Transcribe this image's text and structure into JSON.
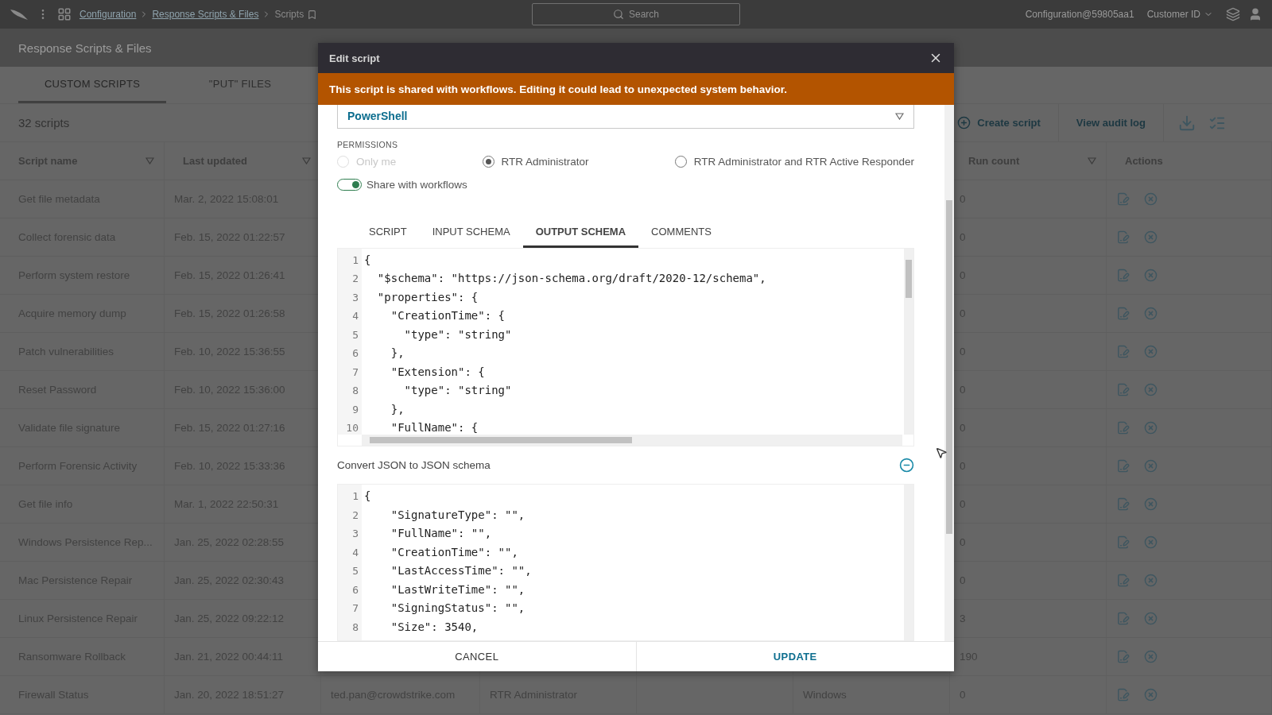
{
  "top_bar": {
    "breadcrumbs": [
      "Configuration",
      "Response Scripts & Files",
      "Scripts"
    ],
    "search": {
      "placeholder": "Search"
    },
    "account": "Configuration@59805aa1",
    "customer_menu": "Customer ID"
  },
  "page_title": "Response Scripts & Files",
  "tabs": [
    {
      "label": "CUSTOM SCRIPTS",
      "selected": true
    },
    {
      "label": "\"PUT\" FILES",
      "selected": false
    }
  ],
  "toolbar": {
    "count": "32 scripts",
    "create": "Create script",
    "audit": "View audit log"
  },
  "table": {
    "columns": [
      {
        "label": "Script name",
        "filter": true
      },
      {
        "label": "Last updated",
        "filter": true
      },
      {
        "label": "Run count",
        "filter": true
      },
      {
        "label": "Actions",
        "filter": false
      }
    ],
    "rows": [
      {
        "name": "Get file metadata",
        "last_updated": "Mar. 2, 2022 15:08:01",
        "run_count": "0"
      },
      {
        "name": "Collect forensic data",
        "last_updated": "Feb. 15, 2022 01:22:57",
        "run_count": "0"
      },
      {
        "name": "Perform system restore",
        "last_updated": "Feb. 15, 2022 01:26:41",
        "run_count": "0"
      },
      {
        "name": "Acquire memory dump",
        "last_updated": "Feb. 15, 2022 01:26:58",
        "run_count": "0"
      },
      {
        "name": "Patch vulnerabilities",
        "last_updated": "Feb. 10, 2022 15:36:55",
        "run_count": "0"
      },
      {
        "name": "Reset Password",
        "last_updated": "Feb. 10, 2022 15:36:00",
        "run_count": "0"
      },
      {
        "name": "Validate file signature",
        "last_updated": "Feb. 15, 2022 01:27:16",
        "run_count": "0"
      },
      {
        "name": "Perform Forensic Activity",
        "last_updated": "Feb. 10, 2022 15:33:36",
        "run_count": "0"
      },
      {
        "name": "Get file info",
        "last_updated": "Mar. 1, 2022 22:50:31",
        "run_count": "0"
      },
      {
        "name": "Windows Persistence Rep...",
        "last_updated": "Jan. 25, 2022 02:28:55",
        "run_count": "0"
      },
      {
        "name": "Mac Persistence Repair",
        "last_updated": "Jan. 25, 2022 02:30:43",
        "run_count": "0"
      },
      {
        "name": "Linux Persistence Repair",
        "last_updated": "Jan. 25, 2022 09:22:12",
        "run_count": "3"
      },
      {
        "name": "Ransomware Rollback",
        "last_updated": "Jan. 21, 2022 00:44:11",
        "run_count": "190"
      },
      {
        "name": "Firewall Status",
        "last_updated": "Jan. 20, 2022 18:51:27",
        "column_3": "ted.pan@crowdstrike.com",
        "column_4": "RTR Administrator",
        "column_6": "Windows",
        "run_count": "0"
      }
    ]
  },
  "modal": {
    "title": "Edit script",
    "warning": "This script is shared with workflows. Editing it could lead to unexpected system behavior.",
    "language": "PowerShell",
    "permissions_label": "PERMISSIONS",
    "permissions": [
      {
        "label": "Only me",
        "selected": false,
        "disabled": true
      },
      {
        "label": "RTR Administrator",
        "selected": true,
        "disabled": false
      },
      {
        "label": "RTR Administrator and RTR Active Responder",
        "selected": false,
        "disabled": false
      }
    ],
    "share": {
      "label": "Share with workflows",
      "on": true
    },
    "tabs": [
      {
        "label": "SCRIPT",
        "selected": false
      },
      {
        "label": "INPUT SCHEMA",
        "selected": false
      },
      {
        "label": "OUTPUT SCHEMA",
        "selected": true
      },
      {
        "label": "COMMENTS",
        "selected": false
      }
    ],
    "schema_lines": [
      {
        "number": "1",
        "text": "{"
      },
      {
        "number": "2",
        "text": "  \"$schema\": \"https://json-schema.org/draft/2020-12/schema\","
      },
      {
        "number": "3",
        "text": "  \"properties\": {"
      },
      {
        "number": "4",
        "text": "    \"CreationTime\": {"
      },
      {
        "number": "5",
        "text": "      \"type\": \"string\""
      },
      {
        "number": "6",
        "text": "    },"
      },
      {
        "number": "7",
        "text": "    \"Extension\": {"
      },
      {
        "number": "8",
        "text": "      \"type\": \"string\""
      },
      {
        "number": "9",
        "text": "    },"
      },
      {
        "number": "10",
        "text": "    \"FullName\": {"
      }
    ],
    "convert_label": "Convert JSON to JSON schema",
    "convert_lines": [
      {
        "number": "1",
        "text": "{"
      },
      {
        "number": "2",
        "text": "    \"SignatureType\": \"\","
      },
      {
        "number": "3",
        "text": "    \"FullName\": \"\","
      },
      {
        "number": "4",
        "text": "    \"CreationTime\": \"\","
      },
      {
        "number": "5",
        "text": "    \"LastAccessTime\": \"\","
      },
      {
        "number": "6",
        "text": "    \"LastWriteTime\": \"\","
      },
      {
        "number": "7",
        "text": "    \"SigningStatus\": \"\","
      },
      {
        "number": "8",
        "text": "    \"Size\": 3540,"
      }
    ],
    "buttons": [
      {
        "label": "CANCEL",
        "kind": "secondary"
      },
      {
        "label": "UPDATE",
        "kind": "primary"
      }
    ]
  }
}
